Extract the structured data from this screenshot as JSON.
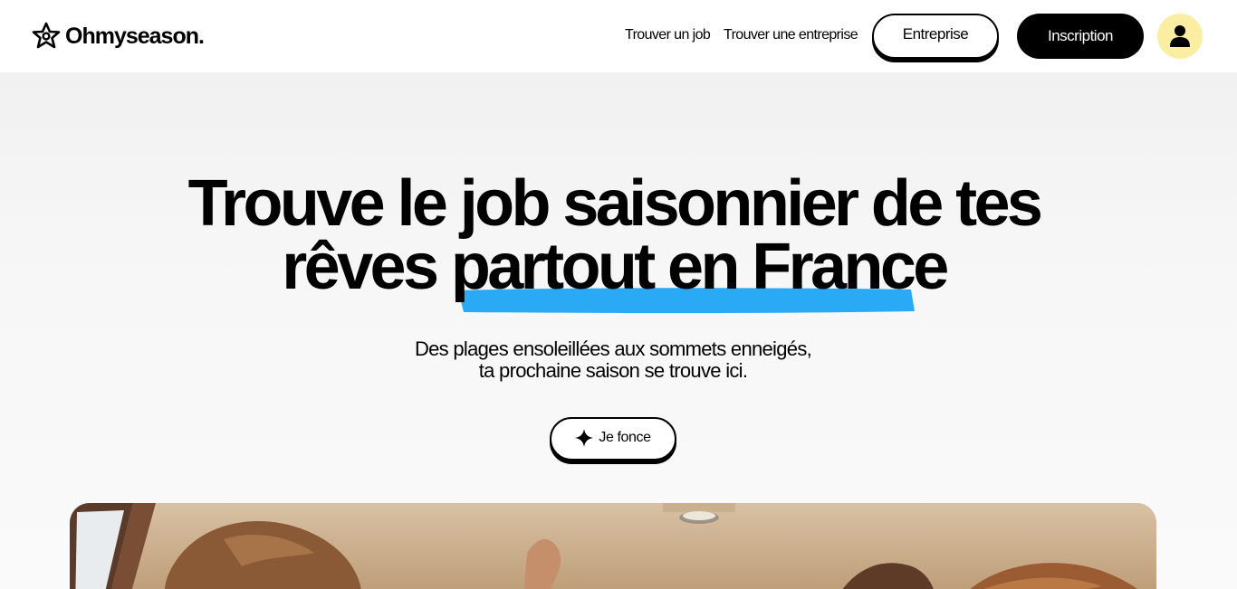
{
  "header": {
    "logo_text": "Ohmyseason.",
    "nav": [
      {
        "label": "Trouver un job"
      },
      {
        "label": "Trouver une entreprise"
      }
    ],
    "entreprise_label": "Entreprise",
    "inscription_label": "Inscription",
    "icons": {
      "logo": "star-flower-icon",
      "account": "user-icon"
    }
  },
  "hero": {
    "title_part1": "Trouve le job saisonnier de tes",
    "title_part2": "rêves",
    "title_highlight": "partout en France",
    "subtitle_line1": "Des plages ensoleillées aux sommets enneigés,",
    "subtitle_line2": "ta prochaine saison se trouve ici.",
    "cta_label": "Je fonce",
    "cta_icon": "sparkle-icon"
  },
  "colors": {
    "accent_blue": "#2aaaf4",
    "avatar_bg": "#fbeea2",
    "primary": "#000000",
    "hero_bg": "#f3f3f3"
  }
}
